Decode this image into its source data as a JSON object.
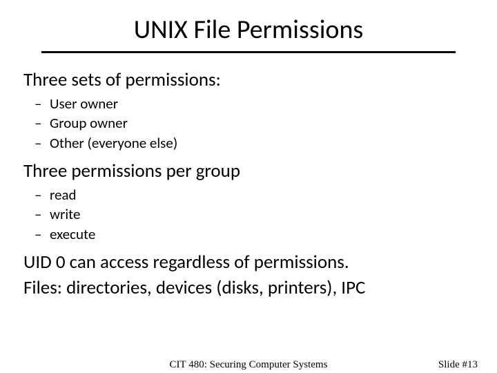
{
  "title": "UNIX File Permissions",
  "section1": {
    "heading": "Three sets of permissions:",
    "items": [
      "User owner",
      "Group owner",
      "Other (everyone else)"
    ]
  },
  "section2": {
    "heading": "Three permissions per group",
    "items": [
      "read",
      "write",
      "execute"
    ]
  },
  "line1": "UID 0 can access regardless of permissions.",
  "line2": "Files: directories, devices (disks, printers), IPC",
  "footer": {
    "center": "CIT 480: Securing Computer Systems",
    "right": "Slide #13"
  }
}
